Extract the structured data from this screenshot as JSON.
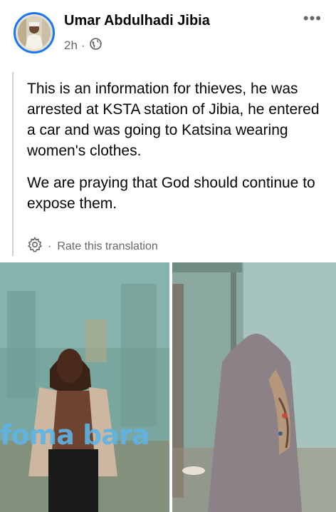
{
  "post": {
    "author": "Umar Abdulhadi Jibia",
    "time": "2h",
    "privacy_icon": "globe-icon",
    "more_icon": "more-options-icon",
    "paragraphs": [
      "This is an information for thieves, he was arrested at KSTA station of Jibia, he entered a car and was going to Katsina wearing women's clothes.",
      "We are praying that God should continue to expose them."
    ],
    "translation": {
      "icon": "gear-icon",
      "label": "Rate this translation"
    }
  },
  "photos": {
    "left": {
      "watermark": "foma bara"
    },
    "right": {}
  },
  "colors": {
    "avatar_ring": "#1877f2",
    "meta_text": "#65676b",
    "quote_bar": "#ccd0d5",
    "watermark": "#5fb4e6"
  }
}
